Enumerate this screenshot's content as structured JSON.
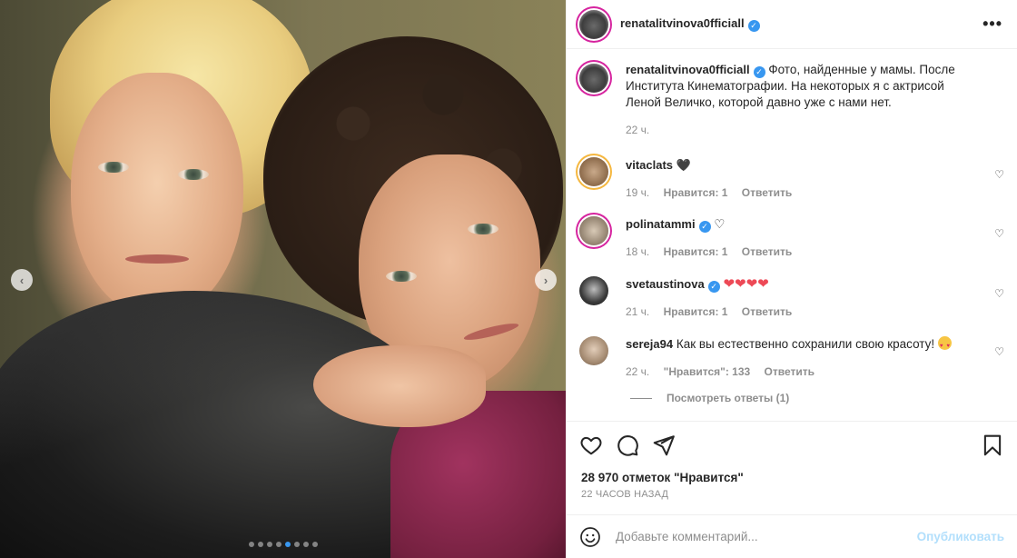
{
  "post": {
    "author": "renatalitvinova0fficiall",
    "more_icon": "ellipsis-icon"
  },
  "carousel": {
    "prev_icon": "chevron-left-icon",
    "next_icon": "chevron-right-icon",
    "prev_glyph": "‹",
    "next_glyph": "›",
    "slide_count": 8,
    "active_index": 4
  },
  "caption": {
    "author": "renatalitvinova0fficiall",
    "text": "Фото, найденные у мамы. После Института Кинематографии. На некоторых я с актрисой Леной Величко, которой давно уже с нами нет.",
    "time": "22 ч."
  },
  "comments": [
    {
      "user": "vitaclats",
      "text": "🖤",
      "time": "19 ч.",
      "likes": "Нравится: 1",
      "reply": "Ответить",
      "verified": false
    },
    {
      "user": "polinatammi",
      "text": "♡",
      "time": "18 ч.",
      "likes": "Нравится: 1",
      "reply": "Ответить",
      "verified": true
    },
    {
      "user": "svetaustinova",
      "text": "❤❤❤❤",
      "time": "21 ч.",
      "likes": "Нравится: 1",
      "reply": "Ответить",
      "verified": true
    },
    {
      "user": "sereja94",
      "text": "Как вы естественно сохранили свою красоту!",
      "time": "22 ч.",
      "likes": "\"Нравится\": 133",
      "reply": "Ответить",
      "verified": false
    }
  ],
  "view_replies": "Посмотреть ответы (1)",
  "likes_text": "28 970 отметок \"Нравится\"",
  "posted_ago": "22 ЧАСОВ НАЗАД",
  "comment_box": {
    "placeholder": "Добавьте комментарий...",
    "publish_label": "Опубликовать"
  },
  "colors": {
    "accent": "#3897f0",
    "publish": "#b2dffc",
    "muted": "#8e8e8e",
    "heart_red": "#ed4956"
  }
}
